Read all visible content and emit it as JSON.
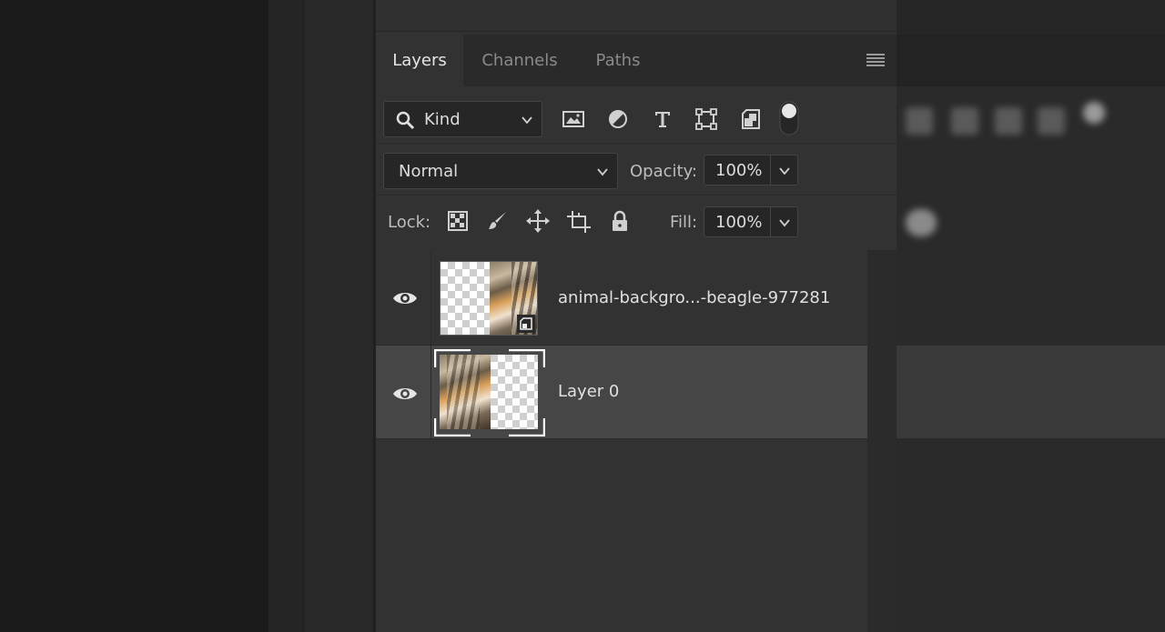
{
  "tabs": [
    {
      "label": "Layers",
      "active": true
    },
    {
      "label": "Channels",
      "active": false
    },
    {
      "label": "Paths",
      "active": false
    }
  ],
  "filter": {
    "kind_label": "Kind"
  },
  "blend": {
    "mode": "Normal"
  },
  "opacity": {
    "label": "Opacity:",
    "value": "100%"
  },
  "lock": {
    "label": "Lock:"
  },
  "fill": {
    "label": "Fill:",
    "value": "100%"
  },
  "layers": [
    {
      "name": "animal-backgro...-beagle-977281",
      "visible": true,
      "smart_object": true,
      "selected": false
    },
    {
      "name": "Layer 0",
      "visible": true,
      "smart_object": false,
      "selected": true
    }
  ],
  "colors": {
    "panel_bg": "#323232",
    "selected_row": "#464646",
    "tab_bar": "#2a2a2a"
  },
  "icons": [
    "search-icon",
    "chevron-down-icon",
    "image-filter-icon",
    "adjustment-filter-icon",
    "type-filter-icon",
    "shape-filter-icon",
    "smart-object-filter-icon",
    "filter-toggle-icon",
    "lock-transparent-icon",
    "lock-image-icon",
    "lock-position-icon",
    "lock-artboard-icon",
    "lock-all-icon",
    "eye-icon",
    "panel-menu-icon"
  ]
}
